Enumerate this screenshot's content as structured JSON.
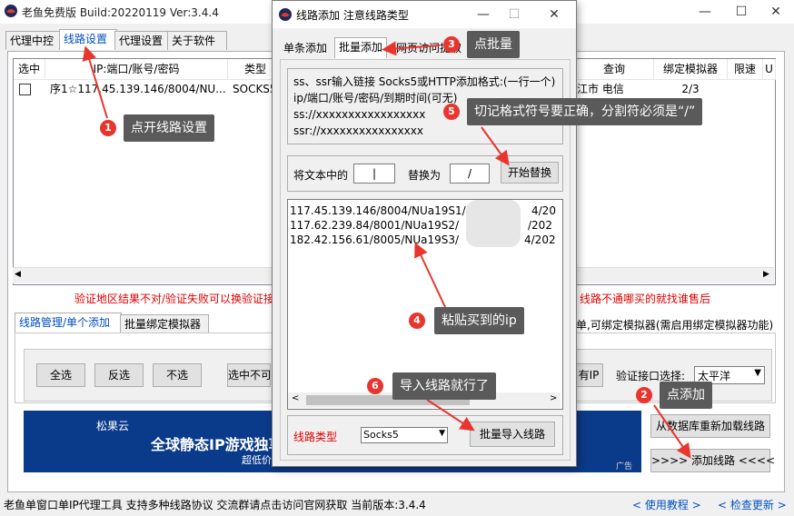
{
  "main_window": {
    "title": "老鱼免费版 Build:20220119 Ver:3.4.4",
    "buttons": {
      "minimize": "—",
      "maximize": "☐",
      "close": "✕"
    },
    "tabs": [
      "代理中控",
      "线路设置",
      "代理设置",
      "关于软件"
    ],
    "active_tab": "线路设置",
    "grid": {
      "headers": [
        "选中",
        "IP:端口/账号/密码",
        "类型",
        "查询",
        "绑定模拟器",
        "限速",
        "U"
      ],
      "row": {
        "ip": "序1☆117.45.139.146/8004/NU...",
        "type": "SOCKS5",
        "location": "江市 电信",
        "bound": "2/3"
      }
    },
    "warning_left": "验证地区结果不对/验证失败可以换验证接",
    "warning_right": "线路不通哪买的就找谁售后",
    "subtabs": [
      "线路管理/单个添加",
      "批量绑定模拟器"
    ],
    "subtab_hint": "单,可绑定模拟器(需启用绑定模拟器功能)",
    "select_buttons": [
      "全选",
      "反选",
      "不选",
      "选中不可"
    ],
    "has_ip_button": "有IP",
    "verify_label": "验证接口选择:",
    "verify_value": "太平洋",
    "reload_button": "从数据库重新加载线路",
    "add_line_button": ">>>>    添加线路    <<<<",
    "ad": {
      "brand": "松果云",
      "headline": "全球静态IP游戏独享",
      "sub": "超低价",
      "tag": "广告"
    },
    "status": {
      "text": "老鱼单窗口单IP代理工具 支持多种线路协议 交流群请点击访问官网获取  当前版本:3.4.4",
      "help": "< 使用教程 >",
      "update": "< 检查更新 >"
    }
  },
  "dialog": {
    "title": "线路添加 注意线路类型",
    "buttons": {
      "minimize": "—",
      "maximize": "☐",
      "close": "✕"
    },
    "tabs": [
      "单条添加",
      "批量添加",
      "网页访问提取"
    ],
    "format_lines": [
      "ss、ssr输入链接 Socks5或HTTP添加格式:(一行一个)",
      "ip/端口/账号/密码/到期时间(可无)",
      "ss://xxxxxxxxxxxxxxxxx",
      "ssr://xxxxxxxxxxxxxxxx"
    ],
    "replace": {
      "label_from": "将文本中的",
      "from": "|",
      "label_to": "替换为",
      "to": "/",
      "button": "开始替换"
    },
    "ips": [
      "117.45.139.146/8004/NUa19S1/",
      "117.62.239.84/8001/NUa19S2/",
      "182.42.156.61/8005/NUa19S3/"
    ],
    "ip_tails": [
      "4/20",
      "/202",
      "4/202"
    ],
    "line_type_label": "线路类型",
    "line_type_value": "Socks5",
    "import_button": "批量导入线路"
  },
  "callouts": [
    {
      "n": "1",
      "text": "点开线路设置"
    },
    {
      "n": "2",
      "text": "点添加"
    },
    {
      "n": "3",
      "text": "点批量"
    },
    {
      "n": "4",
      "text": "粘贴买到的ip"
    },
    {
      "n": "5",
      "text": "切记格式符号要正确，分割符必须是“/”"
    },
    {
      "n": "6",
      "text": "导入线路就行了"
    }
  ],
  "colors": {
    "accent": "#0050c0",
    "warning": "#e00000",
    "badge": "#e8352e",
    "callout_bg": "#5a5a5a",
    "ad_bg": "#0a3a8a"
  }
}
